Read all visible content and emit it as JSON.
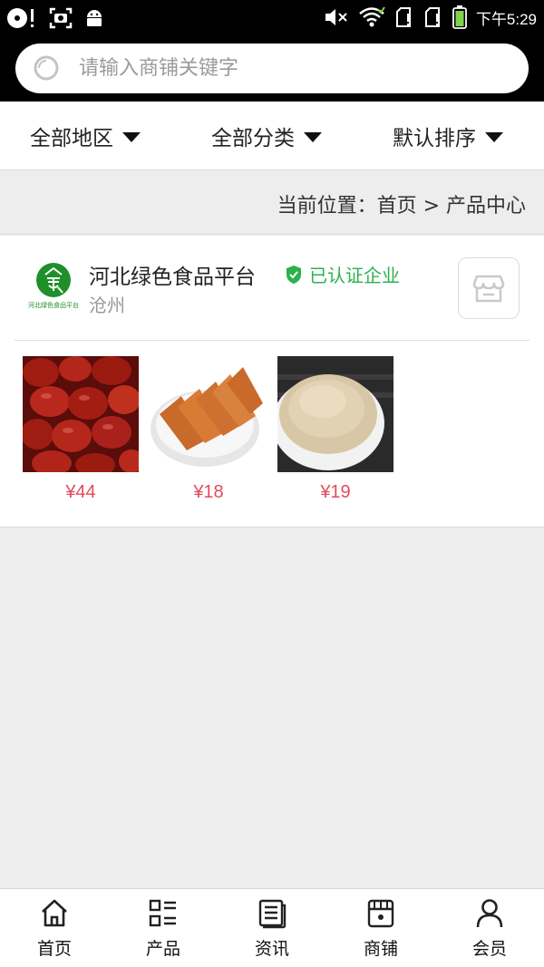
{
  "status_bar": {
    "time": "下午5:29"
  },
  "search": {
    "placeholder": "请输入商铺关键字",
    "value": ""
  },
  "filters": [
    {
      "label": "全部地区"
    },
    {
      "label": "全部分类"
    },
    {
      "label": "默认排序"
    }
  ],
  "breadcrumb": {
    "text": "当前位置：首页 > 产品中心"
  },
  "shop": {
    "name": "河北绿色食品平台",
    "badge": "已认证企业",
    "city": "沧州",
    "logo_text": "河北绿色食品平台",
    "accent_color": "#2bb24c",
    "products": [
      {
        "price": "¥44",
        "image": "red-dates-photo"
      },
      {
        "price": "¥18",
        "image": "jelly-slices-photo"
      },
      {
        "price": "¥19",
        "image": "grain-powder-photo"
      }
    ]
  },
  "bottom_nav": [
    {
      "label": "首页",
      "icon": "home-icon"
    },
    {
      "label": "产品",
      "icon": "product-grid-icon"
    },
    {
      "label": "资讯",
      "icon": "news-icon"
    },
    {
      "label": "商铺",
      "icon": "shop-icon"
    },
    {
      "label": "会员",
      "icon": "user-icon"
    }
  ],
  "colors": {
    "price": "#e24b5c",
    "verified": "#2bb24c",
    "header_bg": "#000000",
    "page_bg": "#ededed"
  }
}
